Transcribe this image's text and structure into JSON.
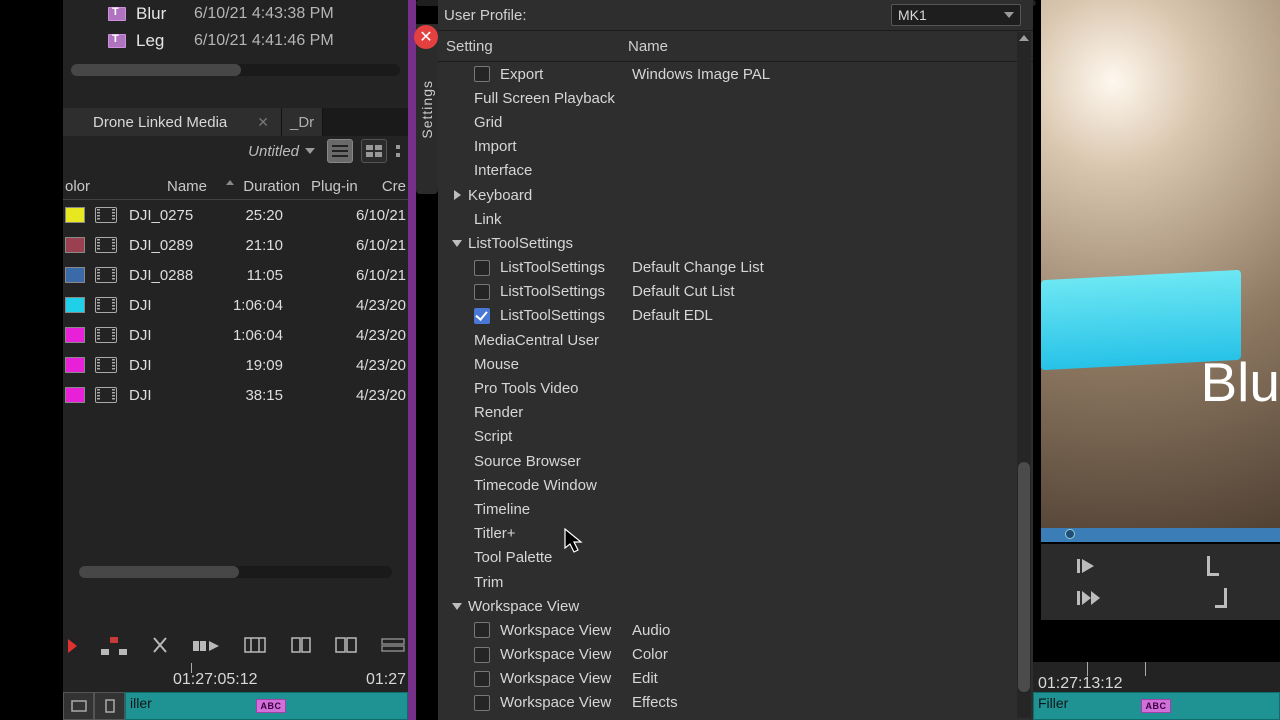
{
  "project_items": [
    {
      "name": "Blur",
      "date": "6/10/21 4:43:38 PM"
    },
    {
      "name": "Leg",
      "date": "6/10/21 4:41:46 PM"
    }
  ],
  "bin": {
    "tab": "Drone Linked Media",
    "partial_tab": "_Dr",
    "sort_dd": "Untitled",
    "columns": {
      "color": "olor",
      "name": "Name",
      "duration": "Duration",
      "plugin": "Plug-in",
      "created": "Cre"
    },
    "rows": [
      {
        "color": "#e8e820",
        "name": "DJI_0275",
        "dur": "25:20",
        "date": "6/10/21"
      },
      {
        "color": "#9a4050",
        "name": "DJI_0289",
        "dur": "21:10",
        "date": "6/10/21"
      },
      {
        "color": "#3a6aa8",
        "name": "DJI_0288",
        "dur": "11:05",
        "date": "6/10/21"
      },
      {
        "color": "#20d0e8",
        "name": "DJI",
        "dur": "1:06:04",
        "date": "4/23/20"
      },
      {
        "color": "#e820d8",
        "name": "DJI",
        "dur": "1:06:04",
        "date": "4/23/20"
      },
      {
        "color": "#e820d8",
        "name": "DJI",
        "dur": "19:09",
        "date": "4/23/20"
      },
      {
        "color": "#e820d8",
        "name": "DJI",
        "dur": "38:15",
        "date": "4/23/20"
      }
    ]
  },
  "settings": {
    "tab_label": "Settings",
    "profile_label": "User Profile:",
    "profile_value": "MK1",
    "col1": "Setting",
    "col2": "Name",
    "rows": [
      {
        "t": "child",
        "ck": false,
        "s": "Export",
        "n": "Windows Image PAL"
      },
      {
        "t": "item",
        "s": "Full Screen Playback"
      },
      {
        "t": "item",
        "s": "Grid"
      },
      {
        "t": "item",
        "s": "Import"
      },
      {
        "t": "item",
        "s": "Interface"
      },
      {
        "t": "group",
        "open": false,
        "s": "Keyboard"
      },
      {
        "t": "item",
        "s": "Link"
      },
      {
        "t": "group",
        "open": true,
        "s": "ListToolSettings"
      },
      {
        "t": "child",
        "ck": false,
        "s": "ListToolSettings",
        "n": "Default Change List"
      },
      {
        "t": "child",
        "ck": false,
        "s": "ListToolSettings",
        "n": "Default Cut List"
      },
      {
        "t": "child",
        "ck": true,
        "s": "ListToolSettings",
        "n": "Default EDL"
      },
      {
        "t": "item",
        "s": "MediaCentral User"
      },
      {
        "t": "item",
        "s": "Mouse"
      },
      {
        "t": "item",
        "s": "Pro Tools Video"
      },
      {
        "t": "item",
        "s": "Render"
      },
      {
        "t": "item",
        "s": "Script"
      },
      {
        "t": "item",
        "s": "Source Browser"
      },
      {
        "t": "item",
        "s": "Timecode Window"
      },
      {
        "t": "item",
        "s": "Timeline"
      },
      {
        "t": "item",
        "s": "Titler+"
      },
      {
        "t": "item",
        "s": "Tool Palette"
      },
      {
        "t": "item",
        "s": "Trim"
      },
      {
        "t": "group",
        "open": true,
        "s": "Workspace View"
      },
      {
        "t": "child",
        "ck": false,
        "s": "Workspace View",
        "n": "Audio"
      },
      {
        "t": "child",
        "ck": false,
        "s": "Workspace View",
        "n": "Color"
      },
      {
        "t": "child",
        "ck": false,
        "s": "Workspace View",
        "n": "Edit"
      },
      {
        "t": "child",
        "ck": false,
        "s": "Workspace View",
        "n": "Effects"
      }
    ]
  },
  "timeline": {
    "left_tc": "01:27:05:12",
    "left_tc2": "01:27",
    "clip": "iller",
    "title_seg": "ABC",
    "right_tc": "01:27:13:12",
    "right_clip": "Filler"
  },
  "viewer": {
    "overlay": "Blu"
  }
}
